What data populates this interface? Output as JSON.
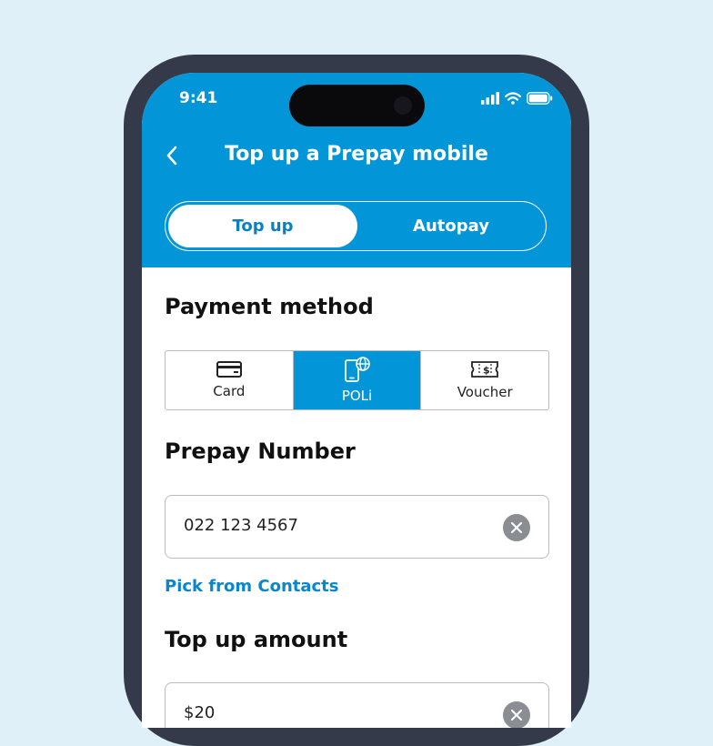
{
  "status": {
    "time": "9:41"
  },
  "header": {
    "title": "Top up a Prepay mobile",
    "back_icon": "chevron-left-icon"
  },
  "tabs": {
    "active": "Top up",
    "inactive": "Autopay"
  },
  "payment_method": {
    "heading": "Payment method",
    "options": [
      {
        "label": "Card",
        "icon": "credit-card-icon",
        "selected": false
      },
      {
        "label": "POLi",
        "icon": "phone-globe-icon",
        "selected": true
      },
      {
        "label": "Voucher",
        "icon": "voucher-ticket-icon",
        "selected": false
      }
    ]
  },
  "prepay": {
    "heading": "Prepay Number",
    "value": "022 123 4567",
    "link": "Pick from Contacts"
  },
  "topup": {
    "heading": "Top up amount",
    "value": "$20"
  },
  "colors": {
    "brand": "#0296d8",
    "background": "#e0f0f9",
    "frame": "#343a4a"
  }
}
